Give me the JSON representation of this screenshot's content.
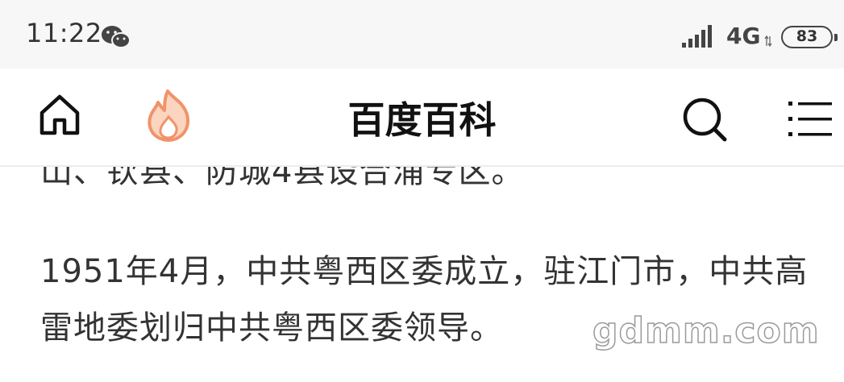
{
  "status_bar": {
    "time": "11:22",
    "network": "4G",
    "battery": "83",
    "icons": [
      "wechat-icon",
      "signal-icon",
      "net-arrows-icon",
      "battery-icon"
    ]
  },
  "nav": {
    "title": "百度百科",
    "icons": [
      "home-icon",
      "fire-icon",
      "search-icon",
      "menu-icon"
    ],
    "accent_color": "#f4a27a"
  },
  "content": {
    "partial_line": "山、钦县、防城4县设合浦专区。",
    "paragraph": "1951年4月，中共粤西区委成立，驻江门市，中共高雷地委划归中共粤西区委领导。"
  },
  "watermark": "gdmm.com"
}
